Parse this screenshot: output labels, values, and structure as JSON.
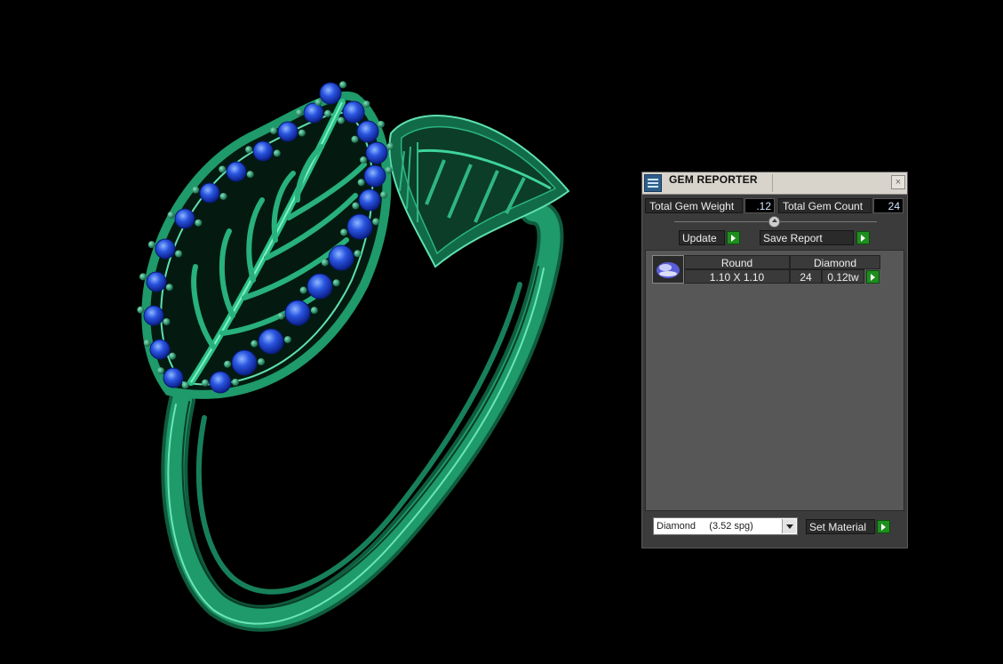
{
  "panel": {
    "title": "GEM REPORTER",
    "close_label": "×",
    "total_weight_label": "Total Gem Weight",
    "total_weight_value": ".12",
    "total_count_label": "Total Gem Count",
    "total_count_value": "24",
    "update_label": "Update",
    "save_report_label": "Save Report",
    "gems": [
      {
        "shape": "Round",
        "material": "Diamond",
        "size": "1.10 X 1.10",
        "count": "24",
        "weight": "0.12tw"
      }
    ],
    "material_select": "Diamond     (3.52 spg)",
    "set_material_label": "Set Material"
  },
  "colors": {
    "metal": "#1f9a6a",
    "metal_dark": "#0f5c3e",
    "metal_light": "#5fe0b0",
    "gem": "#1a3fd0",
    "gem_light": "#6aa0ff",
    "button_arrow": "#1e8e1e"
  }
}
